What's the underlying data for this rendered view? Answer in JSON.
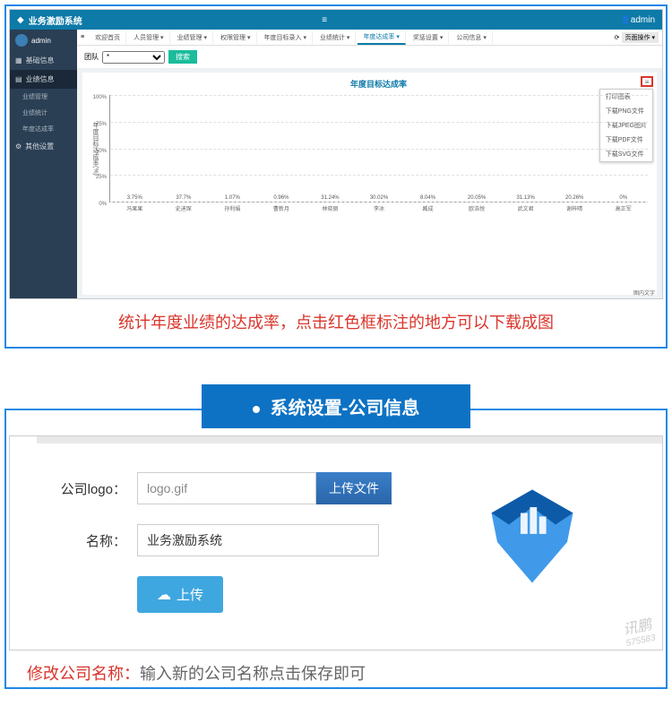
{
  "app": {
    "title": "业务激励系统",
    "user": "admin"
  },
  "sidebar": {
    "username": "admin",
    "items": [
      {
        "label": "基础信息",
        "icon": "▦"
      },
      {
        "label": "业绩信息",
        "icon": "▤"
      }
    ],
    "subitems": [
      {
        "label": "业绩管理"
      },
      {
        "label": "业绩统计"
      },
      {
        "label": "年度达成率"
      }
    ],
    "items2": [
      {
        "label": "其他设置",
        "icon": "⚙"
      }
    ]
  },
  "tabs": {
    "items": [
      {
        "label": "欢迎首页"
      },
      {
        "label": "人员管理 ▾"
      },
      {
        "label": "业绩管理 ▾"
      },
      {
        "label": "权限管理 ▾"
      },
      {
        "label": "年度目标录入 ▾"
      },
      {
        "label": "业绩统计 ▾"
      },
      {
        "label": "年度达成率 ▾",
        "active": true
      },
      {
        "label": "奖惩设置 ▾"
      },
      {
        "label": "公司信息 ▾"
      }
    ],
    "page_op": "页面操作 ▾"
  },
  "filter": {
    "label": "团队",
    "selected": "*",
    "search": "搜索"
  },
  "chart_data": {
    "type": "bar",
    "title": "年度目标达成率",
    "ylabel": "年度目标达成率(%)",
    "ylim": [
      0,
      100
    ],
    "yticks": [
      0,
      25,
      50,
      75,
      100
    ],
    "categories": [
      "冯果果",
      "史迪琛",
      "孙利娟",
      "曹新月",
      "林晓丽",
      "李冰",
      "臧成",
      "欧浩悦",
      "武文君",
      "谢梓晴",
      "高正军"
    ],
    "values": [
      3.75,
      37.7,
      1.07,
      0.96,
      31.24,
      30.02,
      8.04,
      20.05,
      31.13,
      20.26,
      0
    ],
    "legend": "图内文字",
    "menu_items": [
      "打印图表",
      "下载PNG文件",
      "下载JPEG图片",
      "下载PDF文件",
      "下载SVG文件"
    ]
  },
  "captions": {
    "caption1": "统计年度业绩的达成率，点击红色框标注的地方可以下载成图",
    "section2_title": "系统设置-公司信息",
    "caption2_label": "修改公司名称：",
    "caption2_text": "输入新的公司名称点击保存即可"
  },
  "settings": {
    "logo_label": "公司logo：",
    "logo_value": "logo.gif",
    "upload_file": "上传文件",
    "name_label": "名称：",
    "name_value": "业务激励系统",
    "upload_btn": "上传"
  },
  "watermark": {
    "line1": "讯鹏",
    "line2": "575583"
  }
}
